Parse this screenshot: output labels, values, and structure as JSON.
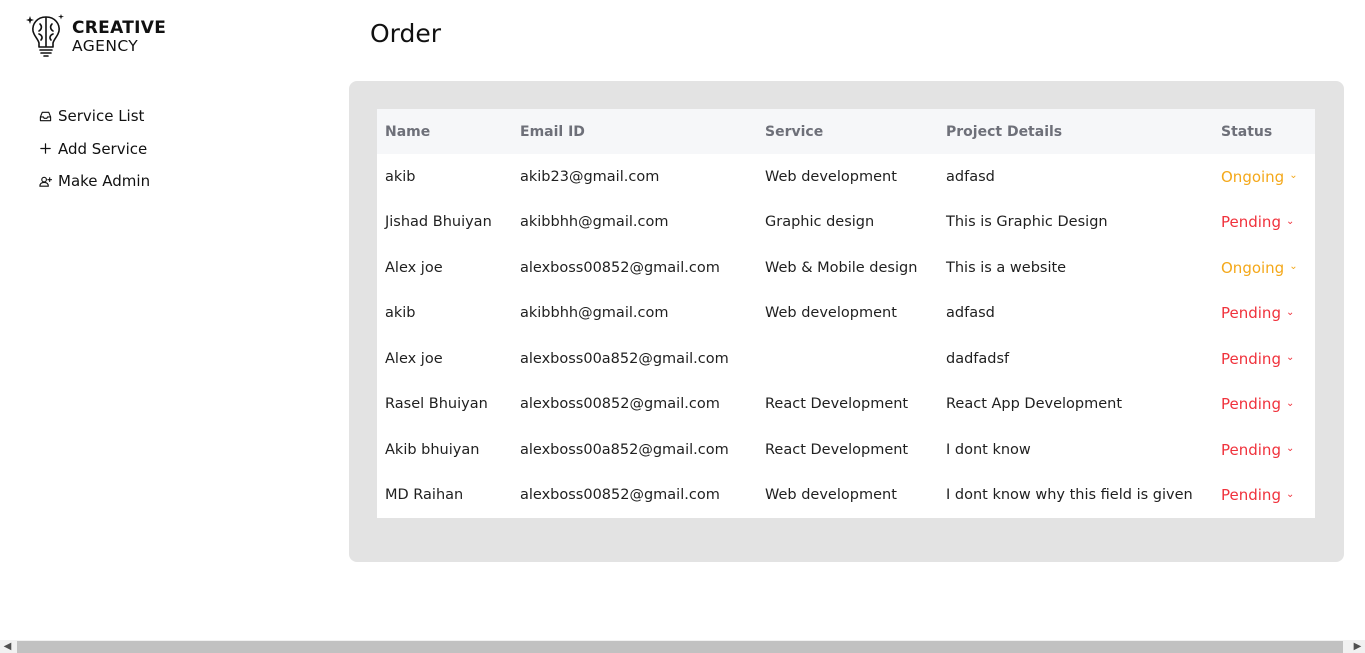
{
  "brand": {
    "line1": "CREATIVE",
    "line2": "AGENCY"
  },
  "sidebar": {
    "items": [
      {
        "label": "Service List",
        "icon": "inbox-icon"
      },
      {
        "label": "Add Service",
        "icon": "plus-icon"
      },
      {
        "label": "Make Admin",
        "icon": "user-plus-icon"
      }
    ]
  },
  "page": {
    "title": "Order"
  },
  "table": {
    "headers": [
      "Name",
      "Email ID",
      "Service",
      "Project Details",
      "Status"
    ],
    "rows": [
      {
        "name": "akib",
        "email": "akib23@gmail.com",
        "service": "Web development",
        "details": "adfasd",
        "status": "Ongoing"
      },
      {
        "name": "Jishad Bhuiyan",
        "email": "akibbhh@gmail.com",
        "service": "Graphic design",
        "details": "This is Graphic Design",
        "status": "Pending"
      },
      {
        "name": "Alex joe",
        "email": "alexboss00852@gmail.com",
        "service": "Web & Mobile design",
        "details": "This is a website",
        "status": "Ongoing"
      },
      {
        "name": "akib",
        "email": "akibbhh@gmail.com",
        "service": "Web development",
        "details": "adfasd",
        "status": "Pending"
      },
      {
        "name": "Alex joe",
        "email": "alexboss00a852@gmail.com",
        "service": "",
        "details": "dadfadsf",
        "status": "Pending"
      },
      {
        "name": "Rasel Bhuiyan",
        "email": "alexboss00852@gmail.com",
        "service": "React Development",
        "details": "React App Development",
        "status": "Pending"
      },
      {
        "name": "Akib bhuiyan",
        "email": "alexboss00a852@gmail.com",
        "service": "React Development",
        "details": "I dont know",
        "status": "Pending"
      },
      {
        "name": "MD Raihan",
        "email": "alexboss00852@gmail.com",
        "service": "Web development",
        "details": "I dont know why this field is given",
        "status": "Pending"
      }
    ]
  },
  "colors": {
    "ongoing": "#f4a81a",
    "pending": "#f0323c",
    "panel_bg": "#e3e3e3",
    "header_text": "#6e7079"
  }
}
